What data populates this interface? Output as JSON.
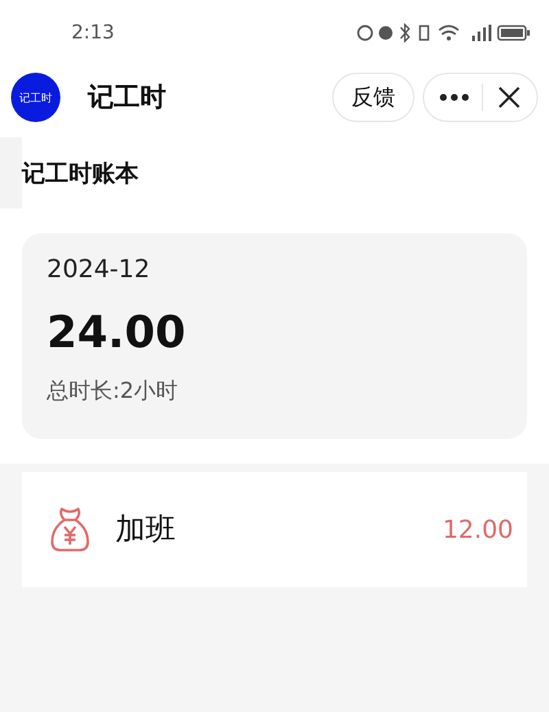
{
  "status_bar": {
    "time": "2:13"
  },
  "header": {
    "logo_text": "记工时",
    "title": "记工时",
    "feedback_button": "反馈"
  },
  "page_title": "记工时账本",
  "summary": {
    "month": "2024-12",
    "total": "24.00",
    "duration": "总时长:2小时"
  },
  "entries": [
    {
      "label": "加班",
      "amount": "12.00"
    }
  ]
}
